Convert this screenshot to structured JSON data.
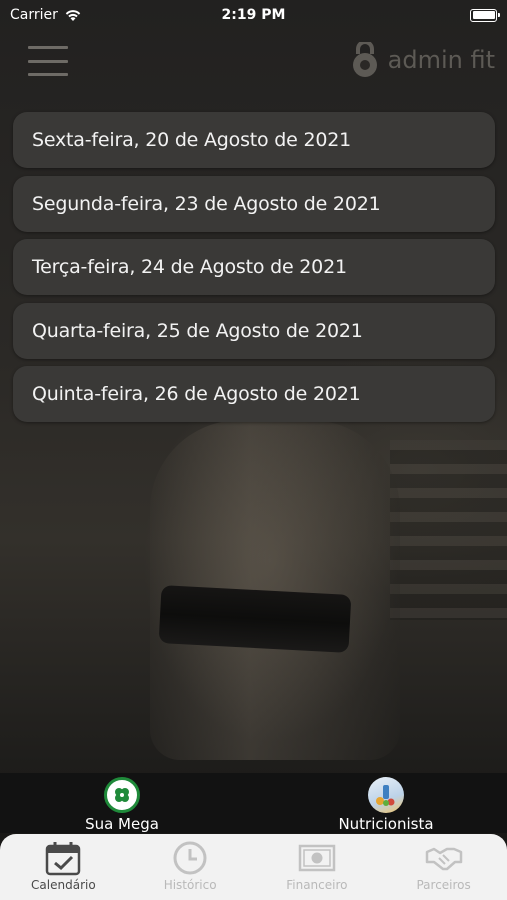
{
  "status_bar": {
    "carrier": "Carrier",
    "time": "2:19 PM"
  },
  "header": {
    "brand": "admin fit",
    "brand_icon": "kettlebell-icon",
    "menu_icon": "hamburger-icon"
  },
  "dates": [
    "Sexta-feira, 20 de Agosto de 2021",
    "Segunda-feira, 23 de Agosto de 2021",
    "Terça-feira, 24 de Agosto de 2021",
    "Quarta-feira, 25 de Agosto de 2021",
    "Quinta-feira, 26 de Agosto de 2021"
  ],
  "quick_links": [
    {
      "label": "Sua Mega",
      "icon": "clover-icon"
    },
    {
      "label": "Nutricionista",
      "icon": "nutrition-icon"
    }
  ],
  "tabs": [
    {
      "label": "Calendário",
      "icon": "calendar-check-icon",
      "active": true
    },
    {
      "label": "Histórico",
      "icon": "clock-icon",
      "active": false
    },
    {
      "label": "Financeiro",
      "icon": "banknote-icon",
      "active": false
    },
    {
      "label": "Parceiros",
      "icon": "handshake-icon",
      "active": false
    }
  ],
  "colors": {
    "accent_green": "#1f8a3a",
    "card_bg": "#3a3937",
    "tab_bar_bg": "#f2f2f2"
  }
}
